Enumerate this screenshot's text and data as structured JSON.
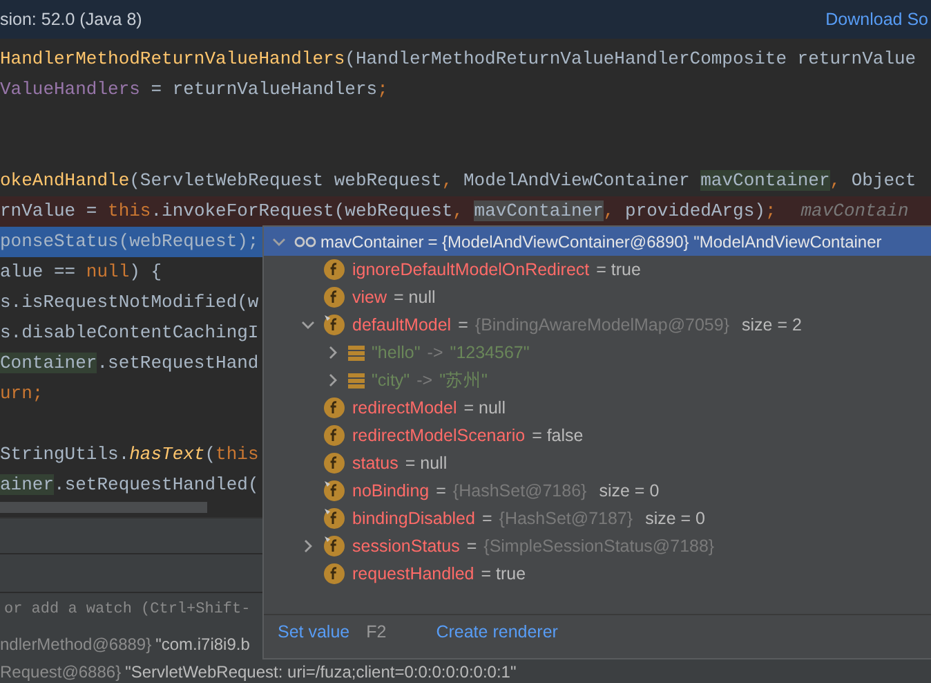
{
  "banner": {
    "text": "sion: 52.0 (Java 8)",
    "link": "Download So"
  },
  "editor": {
    "blocks": [
      [
        {
          "selected": false,
          "breakpoint": false,
          "tokens": [
            {
              "text": "HandlerMethodReturnValueHandlers",
              "kind": "method"
            },
            {
              "text": "(HandlerMethodReturnValueHandlerComposite returnValue",
              "kind": "plain"
            }
          ]
        },
        {
          "selected": false,
          "breakpoint": false,
          "tokens": [
            {
              "text": "ValueHandlers",
              "kind": "field"
            },
            {
              "text": " = returnValueHandlers",
              "kind": "plain"
            },
            {
              "text": ";",
              "kind": "keyword"
            }
          ]
        }
      ],
      [
        {
          "selected": false,
          "breakpoint": false,
          "tokens": [
            {
              "text": "okeAndHandle",
              "kind": "method"
            },
            {
              "text": "(ServletWebRequest webRequest",
              "kind": "plain"
            },
            {
              "text": ", ",
              "kind": "keyword"
            },
            {
              "text": "ModelAndViewContainer ",
              "kind": "plain"
            },
            {
              "text": "mavContainer",
              "kind": "declaration_ref"
            },
            {
              "text": ", ",
              "kind": "keyword"
            },
            {
              "text": "Object",
              "kind": "plain"
            }
          ]
        },
        {
          "selected": false,
          "breakpoint": true,
          "tokens": [
            {
              "text": "rnValue = ",
              "kind": "plain"
            },
            {
              "text": "this",
              "kind": "keyword"
            },
            {
              "text": ".invokeForRequest(webRequest",
              "kind": "plain"
            },
            {
              "text": ", ",
              "kind": "keyword"
            },
            {
              "text": "mavContainer",
              "kind": "read_ref"
            },
            {
              "text": ", ",
              "kind": "keyword"
            },
            {
              "text": "providedArgs)",
              "kind": "plain"
            },
            {
              "text": ";",
              "kind": "keyword"
            },
            {
              "text": "mavContain",
              "kind": "hint"
            }
          ]
        },
        {
          "selected": true,
          "breakpoint": false,
          "tokens": [
            {
              "text": "ponseStatus(webRequest);",
              "kind": "plain"
            }
          ]
        },
        {
          "selected": false,
          "breakpoint": false,
          "tokens": [
            {
              "text": "alue == ",
              "kind": "plain"
            },
            {
              "text": "null",
              "kind": "keyword"
            },
            {
              "text": ") {",
              "kind": "plain"
            }
          ]
        },
        {
          "selected": false,
          "breakpoint": false,
          "tokens": [
            {
              "text": "s.isRequestNotModified(w",
              "kind": "plain"
            }
          ]
        },
        {
          "selected": false,
          "breakpoint": false,
          "tokens": [
            {
              "text": "s.disableContentCachingI",
              "kind": "plain"
            }
          ]
        },
        {
          "selected": false,
          "breakpoint": false,
          "tokens": [
            {
              "text": "Container",
              "kind": "declaration_ref"
            },
            {
              "text": ".setRequestHand",
              "kind": "plain"
            }
          ]
        },
        {
          "selected": false,
          "breakpoint": false,
          "tokens": [
            {
              "text": "urn;",
              "kind": "keyword"
            }
          ]
        }
      ],
      [
        {
          "selected": false,
          "breakpoint": false,
          "tokens": [
            {
              "text": "StringUtils.",
              "kind": "plain"
            },
            {
              "text": "hasText",
              "kind": "static_method"
            },
            {
              "text": "(",
              "kind": "plain"
            },
            {
              "text": "this",
              "kind": "keyword"
            }
          ]
        },
        {
          "selected": false,
          "breakpoint": false,
          "tokens": [
            {
              "text": "ainer",
              "kind": "declaration_ref"
            },
            {
              "text": ".setRequestHandled(",
              "kind": "plain"
            }
          ]
        }
      ]
    ]
  },
  "debugger": {
    "watch_hint": "or add a watch (Ctrl+Shift-",
    "variables": [
      {
        "name": "ndlerMethod@6889}",
        "value": "\"com.i7i8i9.b"
      },
      {
        "name": "Request@6886}",
        "value": "\"ServletWebRequest: uri=/fuza;client=0:0:0:0:0:0:0:1\""
      }
    ]
  },
  "popup": {
    "header": {
      "name": "mavContainer",
      "value": "= {ModelAndViewContainer@6890} \"ModelAndViewContainer",
      "expanded": true
    },
    "items": [
      {
        "kind": "field",
        "final": false,
        "name": "ignoreDefaultModelOnRedirect",
        "value": "= true"
      },
      {
        "kind": "field",
        "final": false,
        "name": "view",
        "value": "= null"
      },
      {
        "kind": "field",
        "final": true,
        "name": "defaultModel",
        "value": "=",
        "type_info": "{BindingAwareModelMap@7059}",
        "size": "size = 2",
        "expanded": true,
        "children": [
          {
            "kind": "entry",
            "key": "\"hello\"",
            "arrow": "->",
            "value": "\"1234567\"",
            "expanded": false
          },
          {
            "kind": "entry",
            "key": "\"city\"",
            "arrow": "->",
            "value": "\"苏州\"",
            "expanded": false
          }
        ]
      },
      {
        "kind": "field",
        "final": false,
        "name": "redirectModel",
        "value": "= null"
      },
      {
        "kind": "field",
        "final": false,
        "name": "redirectModelScenario",
        "value": "= false"
      },
      {
        "kind": "field",
        "final": false,
        "name": "status",
        "value": "= null"
      },
      {
        "kind": "field",
        "final": true,
        "name": "noBinding",
        "value": "=",
        "type_info": "{HashSet@7186}",
        "size": "size = 0"
      },
      {
        "kind": "field",
        "final": true,
        "name": "bindingDisabled",
        "value": "=",
        "type_info": "{HashSet@7187}",
        "size": "size = 0"
      },
      {
        "kind": "field",
        "final": true,
        "name": "sessionStatus",
        "value": "=",
        "type_info": "{SimpleSessionStatus@7188}",
        "expanded": false
      },
      {
        "kind": "field",
        "final": false,
        "name": "requestHandled",
        "value": "= true"
      }
    ],
    "actions": [
      {
        "label": "Set value",
        "shortcut": "F2"
      },
      {
        "label": "Create renderer"
      }
    ]
  }
}
